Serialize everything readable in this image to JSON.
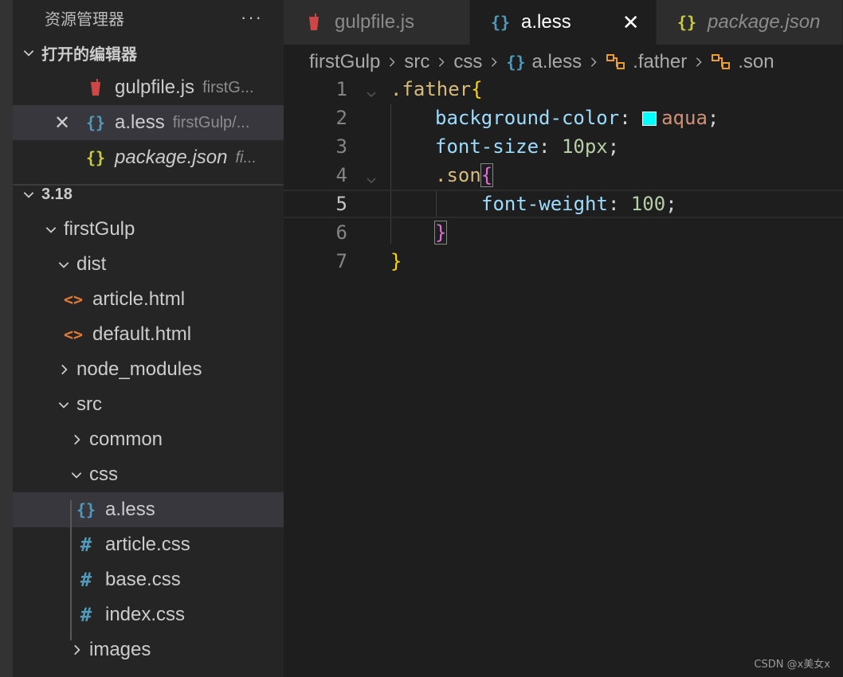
{
  "sidebar": {
    "title": "资源管理器",
    "more": "···",
    "open_editors": {
      "label": "打开的编辑器",
      "items": [
        {
          "name": "gulpfile.js",
          "desc": "firstG..."
        },
        {
          "name": "a.less",
          "desc": "firstGulp/..."
        },
        {
          "name": "package.json",
          "desc": "fi..."
        }
      ]
    },
    "workspace": {
      "label": "3.18",
      "tree": {
        "firstGulp": "firstGulp",
        "dist": "dist",
        "article_html": "article.html",
        "default_html": "default.html",
        "node_modules": "node_modules",
        "src": "src",
        "common": "common",
        "css": "css",
        "a_less": "a.less",
        "article_css": "article.css",
        "base_css": "base.css",
        "index_css": "index.css",
        "images": "images"
      }
    }
  },
  "tabs": [
    {
      "label": "gulpfile.js"
    },
    {
      "label": "a.less",
      "close": "✕"
    },
    {
      "label": "package.json"
    }
  ],
  "breadcrumb": [
    "firstGulp",
    "src",
    "css",
    "a.less",
    ".father",
    ".son"
  ],
  "editor": {
    "lines": [
      "1",
      "2",
      "3",
      "4",
      "5",
      "6",
      "7"
    ],
    "code": {
      "l1_sel": ".father",
      "l1_brace": "{",
      "l2_prop": "background-color",
      "l2_colon": ": ",
      "l2_val": "aqua",
      "l2_semi": ";",
      "l3_prop": "font-size",
      "l3_colon": ": ",
      "l3_val": "10px",
      "l3_semi": ";",
      "l4_sel": ".son",
      "l4_brace": "{",
      "l5_prop": "font-weight",
      "l5_colon": ": ",
      "l5_val": "100",
      "l5_semi": ";",
      "l6_brace": "}",
      "l7_brace": "}"
    },
    "swatch_color": "#00ffff"
  },
  "watermark": "CSDN @x美女x",
  "colors": {
    "selector": "#d7ba7d",
    "property": "#9cdcfe",
    "number": "#b5cea8",
    "string": "#ce9178",
    "brace_outer": "#ffd700",
    "brace_inner": "#da70d6"
  }
}
